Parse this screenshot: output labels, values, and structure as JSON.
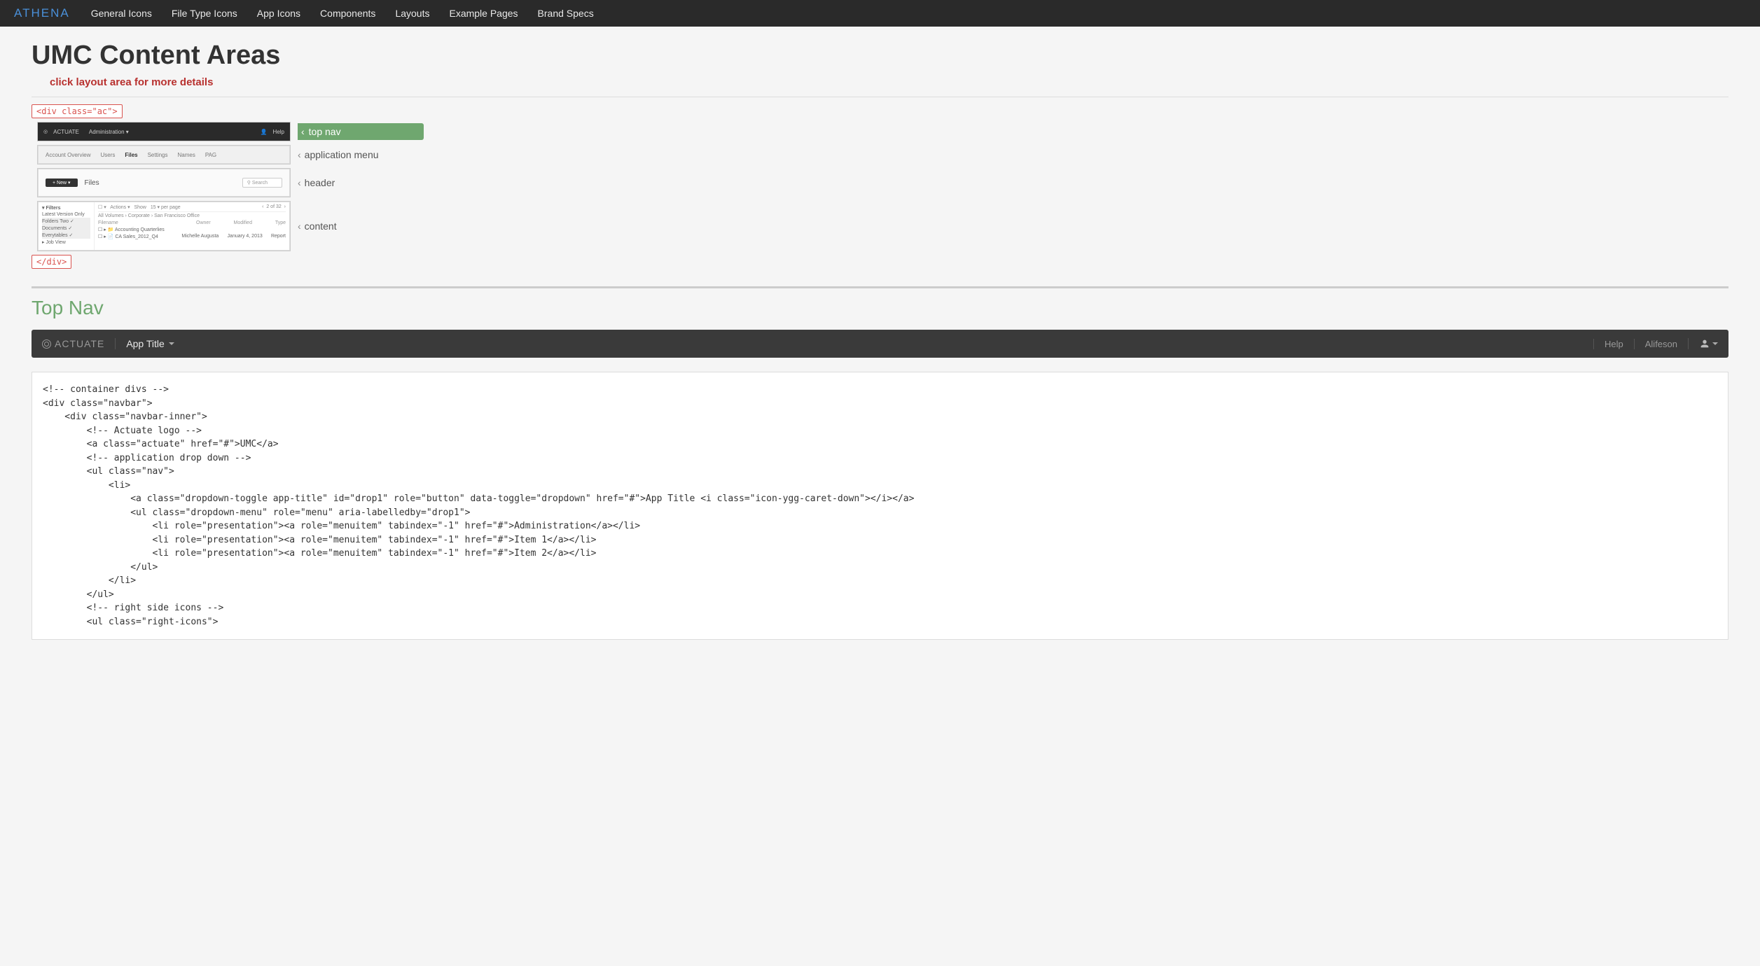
{
  "navbar": {
    "brand": "ATHENA",
    "links": [
      "General Icons",
      "File Type Icons",
      "App Icons",
      "Components",
      "Layouts",
      "Example Pages",
      "Brand Specs"
    ]
  },
  "page": {
    "title": "UMC Content Areas",
    "subtitle": "click layout area for more details",
    "opening_tag": "<div class=\"ac\">",
    "closing_tag": "</div>",
    "areas": [
      {
        "label": "top nav",
        "active": true
      },
      {
        "label": "application menu",
        "active": false
      },
      {
        "label": "header",
        "active": false
      },
      {
        "label": "content",
        "active": false
      }
    ]
  },
  "thumb": {
    "topnav_brand": "ACTUATE",
    "topnav_app": "Administration",
    "topnav_help": "Help",
    "appmenu": [
      "Account Overview",
      "Users",
      "Files",
      "Settings",
      "Names",
      "PAG"
    ],
    "appmenu_active": "Files",
    "header_btn": "+ New ▾",
    "header_title": "Files",
    "header_search": "Search",
    "side_title": "Filters",
    "side_items": [
      "Latest Version Only",
      "Folders Two",
      "Documents",
      "Everytables",
      "Job View"
    ],
    "toolbar_actions": "Actions ▾",
    "toolbar_show": "Show",
    "toolbar_perpage": "15 ▾  per page",
    "toolbar_page": "2 of 32",
    "crumbs": "All Volumes  ›  Corporate  ›  San Francisco Office",
    "cols": [
      "Filename",
      "Owner",
      "Modified",
      "Type"
    ],
    "row1": [
      "Accounting Quarterlies",
      "",
      "",
      ""
    ],
    "row2": [
      "CA Sales_2012_Q4",
      "Michelle Augusta",
      "January 4, 2013",
      "Report"
    ]
  },
  "section": {
    "heading": "Top Nav"
  },
  "demo": {
    "logo": "ACTUATE",
    "app_title": "App Title",
    "help": "Help",
    "user": "Alifeson"
  },
  "code": "<!-- container divs -->\n<div class=\"navbar\">\n    <div class=\"navbar-inner\">\n        <!-- Actuate logo -->\n        <a class=\"actuate\" href=\"#\">UMC</a>\n        <!-- application drop down -->\n        <ul class=\"nav\">\n            <li>\n                <a class=\"dropdown-toggle app-title\" id=\"drop1\" role=\"button\" data-toggle=\"dropdown\" href=\"#\">App Title <i class=\"icon-ygg-caret-down\"></i></a>\n                <ul class=\"dropdown-menu\" role=\"menu\" aria-labelledby=\"drop1\">\n                    <li role=\"presentation\"><a role=\"menuitem\" tabindex=\"-1\" href=\"#\">Administration</a></li>\n                    <li role=\"presentation\"><a role=\"menuitem\" tabindex=\"-1\" href=\"#\">Item 1</a></li>\n                    <li role=\"presentation\"><a role=\"menuitem\" tabindex=\"-1\" href=\"#\">Item 2</a></li>\n                </ul>\n            </li>\n        </ul>\n        <!-- right side icons -->\n        <ul class=\"right-icons\">"
}
